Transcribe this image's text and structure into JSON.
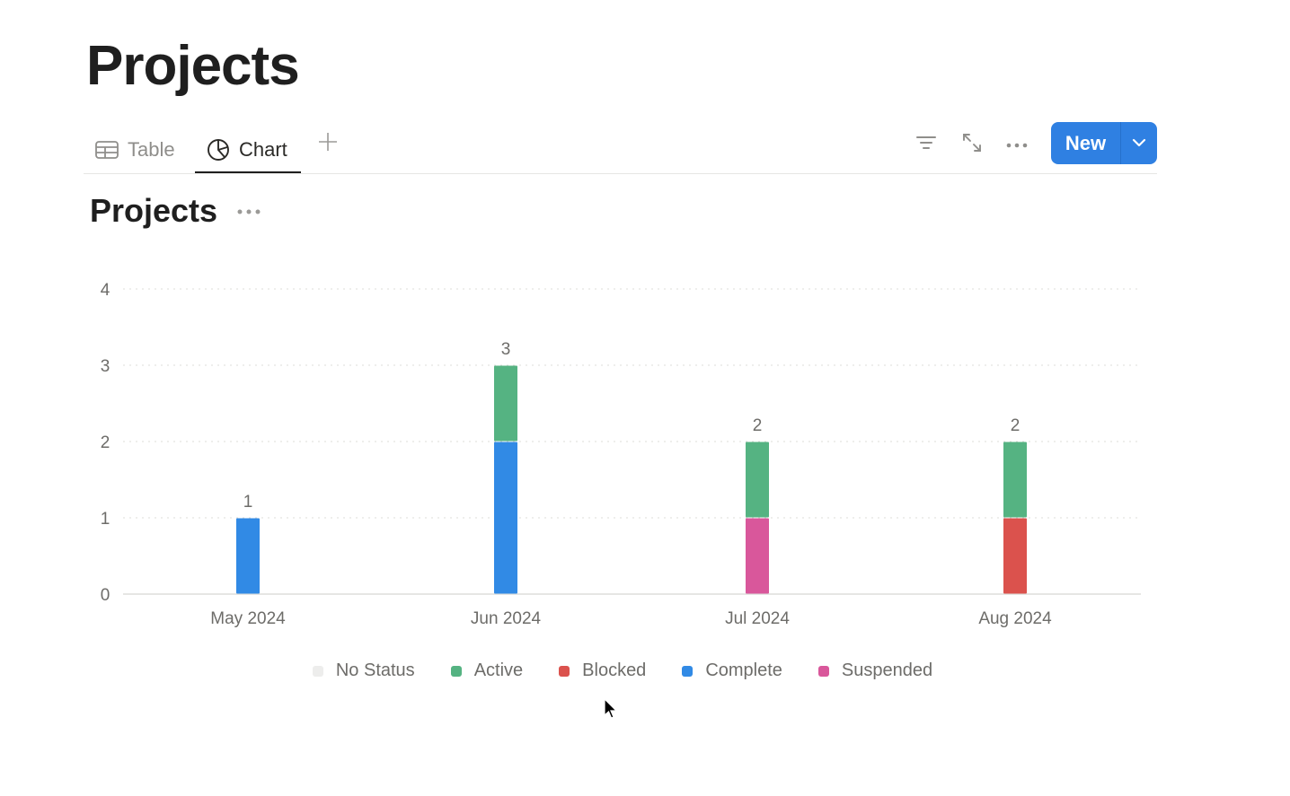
{
  "page": {
    "title": "Projects"
  },
  "views": {
    "tabs": [
      {
        "label": "Table",
        "icon": "table-icon",
        "active": false
      },
      {
        "label": "Chart",
        "icon": "pie-chart-icon",
        "active": true
      }
    ],
    "add_view_icon": "plus-icon"
  },
  "toolbar": {
    "icons": [
      "filter-icon",
      "expand-icon",
      "more-icon"
    ],
    "new_label": "New",
    "new_dropdown_icon": "chevron-down-icon",
    "accent": "#2f80e2"
  },
  "chart_header": {
    "title": "Projects",
    "more_icon": "more-icon"
  },
  "chart_data": {
    "type": "bar",
    "stacked": true,
    "title": "Projects",
    "xlabel": "",
    "ylabel": "",
    "categories": [
      "May 2024",
      "Jun 2024",
      "Jul 2024",
      "Aug 2024"
    ],
    "yticks": [
      0,
      1,
      2,
      3,
      4
    ],
    "ylim": [
      0,
      4
    ],
    "grid": true,
    "legend_position": "bottom",
    "series": [
      {
        "name": "No Status",
        "color": "#ededec",
        "values": [
          0,
          0,
          0,
          0
        ]
      },
      {
        "name": "Complete",
        "color": "#318ae5",
        "values": [
          1,
          2,
          0,
          0
        ]
      },
      {
        "name": "Suspended",
        "color": "#d9579b",
        "values": [
          0,
          0,
          1,
          0
        ]
      },
      {
        "name": "Blocked",
        "color": "#db524d",
        "values": [
          0,
          0,
          0,
          1
        ]
      },
      {
        "name": "Active",
        "color": "#55b382",
        "values": [
          0,
          1,
          1,
          1
        ]
      }
    ],
    "totals": [
      1,
      3,
      2,
      2
    ],
    "legend_order": [
      "No Status",
      "Active",
      "Blocked",
      "Complete",
      "Suspended"
    ]
  }
}
